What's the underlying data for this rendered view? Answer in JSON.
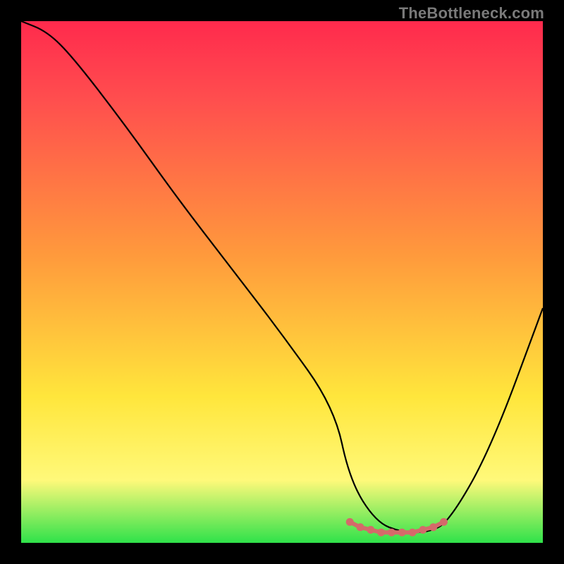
{
  "watermark": "TheBottleneck.com",
  "colors": {
    "top": "#ff2a4d",
    "pink": "#ff4e4e",
    "orange": "#ff9a3c",
    "yellow": "#ffe63c",
    "lightyellow": "#fff97a",
    "green": "#2fe24a",
    "curve": "#000000",
    "marker": "#d46a6a",
    "background": "#000000"
  },
  "chart_data": {
    "type": "line",
    "title": "",
    "xlabel": "",
    "ylabel": "",
    "xlim": [
      0,
      100
    ],
    "ylim": [
      0,
      100
    ],
    "series": [
      {
        "name": "bottleneck-curve",
        "x": [
          0,
          5,
          10,
          20,
          30,
          40,
          50,
          60,
          63,
          68,
          73,
          78,
          82,
          90,
          100
        ],
        "y": [
          100,
          98,
          93,
          80,
          66,
          53,
          40,
          26,
          12,
          4,
          2,
          2,
          4,
          18,
          45
        ]
      }
    ],
    "markers": {
      "name": "optimal-range",
      "x": [
        63,
        65,
        67,
        69,
        71,
        73,
        75,
        77,
        79,
        81
      ],
      "y": [
        4,
        3,
        2.5,
        2,
        2,
        2,
        2,
        2.5,
        3,
        4
      ]
    },
    "gradient_stops": [
      {
        "pct": 0,
        "color": "#ff2a4d"
      },
      {
        "pct": 15,
        "color": "#ff4e4e"
      },
      {
        "pct": 45,
        "color": "#ff9a3c"
      },
      {
        "pct": 72,
        "color": "#ffe63c"
      },
      {
        "pct": 88,
        "color": "#fff97a"
      },
      {
        "pct": 100,
        "color": "#2fe24a"
      }
    ]
  }
}
